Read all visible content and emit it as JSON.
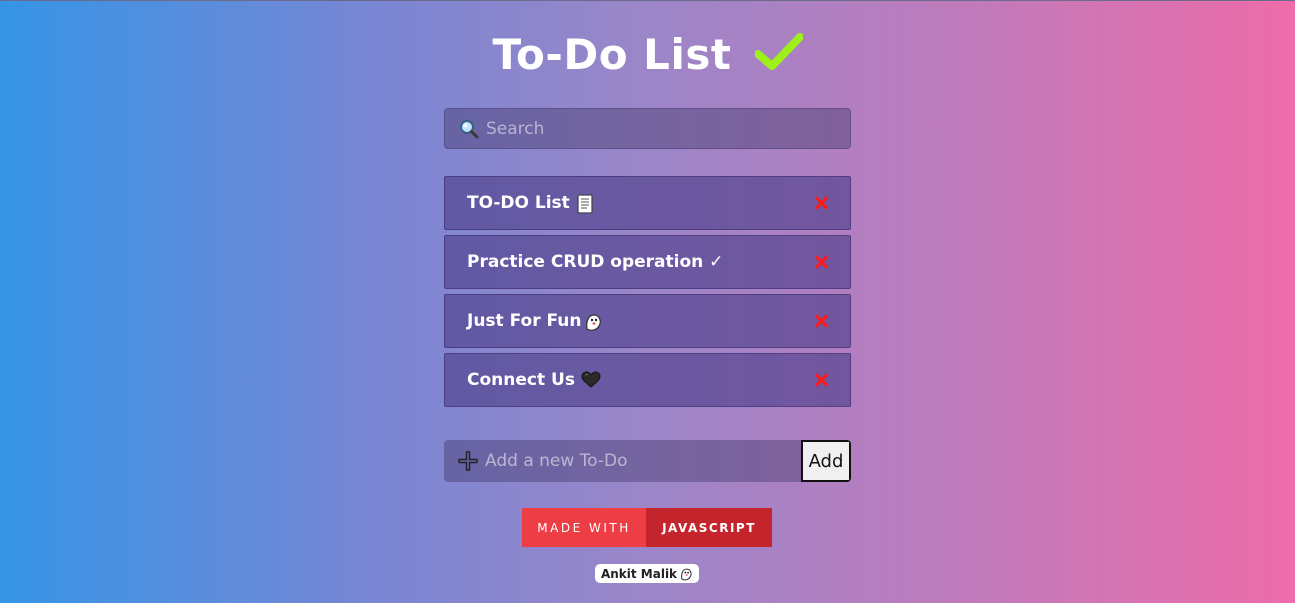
{
  "header": {
    "title": "To-Do List",
    "check_icon": "check-icon",
    "check_color": "#9ef01a"
  },
  "search": {
    "placeholder": "Search",
    "value": "",
    "icon": "search-icon"
  },
  "todos": [
    {
      "label": "TO-DO List",
      "emoji": "scroll-icon"
    },
    {
      "label": "Practice CRUD operation ✓",
      "emoji": ""
    },
    {
      "label": "Just For Fun",
      "emoji": "ghost-icon"
    },
    {
      "label": "Connect Us",
      "emoji": "black-heart-icon"
    }
  ],
  "delete_icon": {
    "name": "close-icon",
    "color": "#ff1a1a"
  },
  "add": {
    "placeholder": "Add a new To-Do",
    "value": "",
    "button_label": "Add",
    "icon": "plus-icon"
  },
  "badge": {
    "left": "MADE WITH",
    "right": "JAVASCRIPT",
    "left_color": "#ec3e44",
    "right_color": "#c4242c"
  },
  "footer": {
    "author": "Ankit Malik"
  }
}
